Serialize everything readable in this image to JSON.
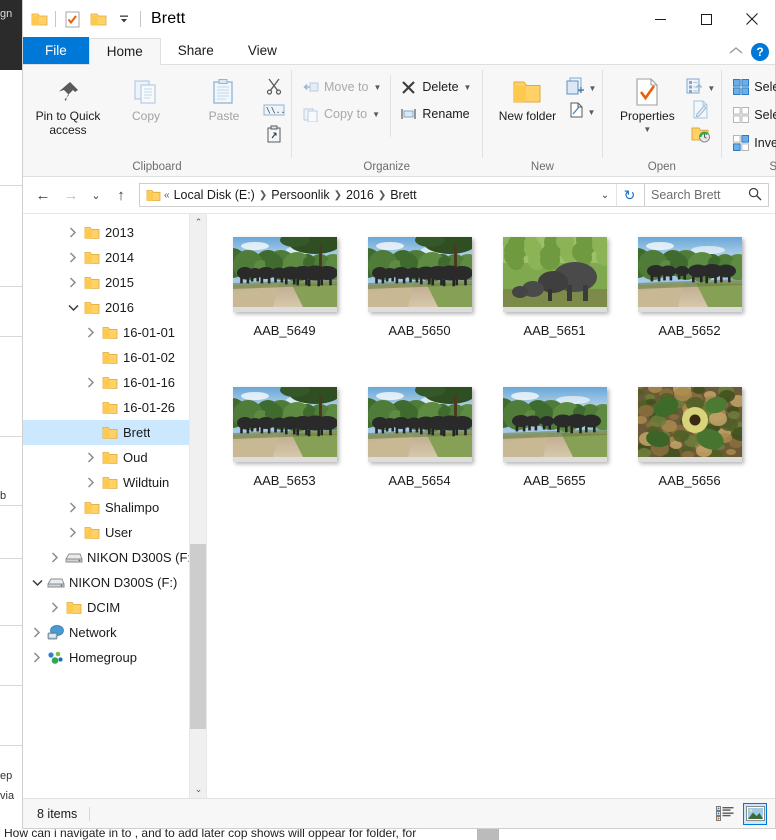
{
  "window": {
    "title": "Brett",
    "quick_access": [
      {
        "name": "folder-icon",
        "label": "Folder"
      },
      {
        "name": "properties-icon",
        "label": "Properties"
      },
      {
        "name": "new-folder-icon",
        "label": "New folder"
      },
      {
        "name": "customize-qat-icon",
        "label": "Customize Quick Access Toolbar"
      }
    ],
    "controls": {
      "minimize": "—",
      "maximize": "□",
      "close": "✕",
      "collapse_ribbon": "⌃",
      "help": "?"
    }
  },
  "ribbon": {
    "tabs": [
      {
        "label": "File",
        "active": false,
        "is_file": true
      },
      {
        "label": "Home",
        "active": true,
        "is_file": false
      },
      {
        "label": "Share",
        "active": false,
        "is_file": false
      },
      {
        "label": "View",
        "active": false,
        "is_file": false
      }
    ],
    "groups": [
      {
        "label": "Clipboard",
        "big_buttons": [
          {
            "label": "Pin to Quick access",
            "dim": false,
            "icon": "pin-icon"
          },
          {
            "label": "Copy",
            "dim": true,
            "icon": "copy-icon"
          },
          {
            "label": "Paste",
            "dim": true,
            "icon": "paste-icon"
          }
        ],
        "small_icons": [
          {
            "label": "Cut",
            "icon": "cut-icon"
          },
          {
            "label": "Copy path",
            "icon": "copy-path-icon"
          },
          {
            "label": "Paste shortcut",
            "icon": "paste-shortcut-icon"
          }
        ]
      },
      {
        "label": "Organize",
        "small_buttons": [
          {
            "label": "Move to",
            "dim": true,
            "icon": "move-to-icon",
            "caret": true
          },
          {
            "label": "Copy to",
            "dim": true,
            "icon": "copy-to-icon",
            "caret": true
          },
          {
            "label": "Delete",
            "dim": false,
            "icon": "delete-icon",
            "caret": true
          },
          {
            "label": "Rename",
            "dim": false,
            "icon": "rename-icon",
            "caret": false
          }
        ]
      },
      {
        "label": "New",
        "big_buttons": [
          {
            "label": "New folder",
            "dim": false,
            "icon": "new-folder-icon"
          }
        ],
        "small_icons": [
          {
            "label": "New item",
            "icon": "new-item-icon"
          },
          {
            "label": "Easy access",
            "icon": "easy-access-icon"
          }
        ]
      },
      {
        "label": "Open",
        "big_buttons": [
          {
            "label": "Properties",
            "dim": false,
            "icon": "properties-icon",
            "caret": true
          }
        ],
        "small_icons": [
          {
            "label": "Open with",
            "icon": "open-with-icon"
          },
          {
            "label": "Edit",
            "icon": "edit-icon"
          },
          {
            "label": "History",
            "icon": "history-icon"
          }
        ]
      },
      {
        "label": "Select",
        "small_buttons": [
          {
            "label": "Select all",
            "icon": "select-all-icon"
          },
          {
            "label": "Select none",
            "icon": "select-none-icon"
          },
          {
            "label": "Invert selection",
            "icon": "invert-selection-icon"
          }
        ]
      }
    ]
  },
  "address_bar": {
    "back": "←",
    "forward": "→",
    "recent": "⌄",
    "up": "↑",
    "overflow": "«",
    "breadcrumbs": [
      "Local Disk (E:)",
      "Persoonlik",
      "2016",
      "Brett"
    ],
    "dropdown": "⌄",
    "refresh": "↻",
    "search_placeholder": "Search Brett",
    "search_value": "",
    "search_icon": "search-icon"
  },
  "nav_pane": {
    "items": [
      {
        "label": "2013",
        "indent": 2,
        "chevron": "collapsed",
        "icon": "folder-icon",
        "selected": false
      },
      {
        "label": "2014",
        "indent": 2,
        "chevron": "collapsed",
        "icon": "folder-icon",
        "selected": false
      },
      {
        "label": "2015",
        "indent": 2,
        "chevron": "collapsed",
        "icon": "folder-icon",
        "selected": false
      },
      {
        "label": "2016",
        "indent": 2,
        "chevron": "expanded",
        "icon": "folder-icon",
        "selected": false
      },
      {
        "label": "16-01-01",
        "indent": 3,
        "chevron": "collapsed",
        "icon": "folder-icon",
        "selected": false
      },
      {
        "label": "16-01-02",
        "indent": 3,
        "chevron": "none",
        "icon": "folder-icon",
        "selected": false
      },
      {
        "label": "16-01-16",
        "indent": 3,
        "chevron": "collapsed",
        "icon": "folder-icon",
        "selected": false
      },
      {
        "label": "16-01-26",
        "indent": 3,
        "chevron": "none",
        "icon": "folder-icon",
        "selected": false
      },
      {
        "label": "Brett",
        "indent": 3,
        "chevron": "none",
        "icon": "folder-icon",
        "selected": true
      },
      {
        "label": "Oud",
        "indent": 3,
        "chevron": "collapsed",
        "icon": "folder-icon",
        "selected": false
      },
      {
        "label": "Wildtuin",
        "indent": 3,
        "chevron": "collapsed",
        "icon": "folder-icon",
        "selected": false
      },
      {
        "label": "Shalimpo",
        "indent": 2,
        "chevron": "collapsed",
        "icon": "folder-icon",
        "selected": false
      },
      {
        "label": "User",
        "indent": 2,
        "chevron": "collapsed",
        "icon": "folder-icon",
        "selected": false
      },
      {
        "label": "NIKON D300S (F:",
        "indent": 1,
        "chevron": "collapsed",
        "icon": "drive-icon",
        "selected": false
      },
      {
        "label": "NIKON D300S (F:)",
        "indent": 0,
        "chevron": "expanded",
        "icon": "drive-icon",
        "selected": false
      },
      {
        "label": "DCIM",
        "indent": 1,
        "chevron": "collapsed",
        "icon": "folder-icon",
        "selected": false
      },
      {
        "label": "Network",
        "indent": 0,
        "chevron": "collapsed",
        "icon": "network-icon",
        "selected": false
      },
      {
        "label": "Homegroup",
        "indent": 0,
        "chevron": "collapsed",
        "icon": "homegroup-icon",
        "selected": false
      }
    ],
    "scrollbar": {
      "up_arrow": "⌃",
      "down_arrow": "⌄"
    }
  },
  "files": [
    {
      "name": "AAB_5649",
      "scene": "elephants-road-wide"
    },
    {
      "name": "AAB_5650",
      "scene": "elephants-road-wide"
    },
    {
      "name": "AAB_5651",
      "scene": "elephants-closeup-bush"
    },
    {
      "name": "AAB_5652",
      "scene": "elephants-crossing-road"
    },
    {
      "name": "AAB_5653",
      "scene": "elephants-road-herd"
    },
    {
      "name": "AAB_5654",
      "scene": "elephants-road-herd"
    },
    {
      "name": "AAB_5655",
      "scene": "elephants-crossing-road"
    },
    {
      "name": "AAB_5656",
      "scene": "yellow-flower-leaves"
    }
  ],
  "status_bar": {
    "item_count": "8 items",
    "views": [
      {
        "name": "details-view-button",
        "label": "Details",
        "active": false
      },
      {
        "name": "large-icons-view-button",
        "label": "Large icons",
        "active": true
      }
    ]
  },
  "background_window": {
    "bottom_text": "How can i navigate in to , and to add later cop shows will oppear for folder, for"
  },
  "colors": {
    "accent": "#0078d7",
    "selection": "#cce8ff",
    "ribbon_bg": "#f7f7f7",
    "folder_yellow": "#ffd166"
  }
}
